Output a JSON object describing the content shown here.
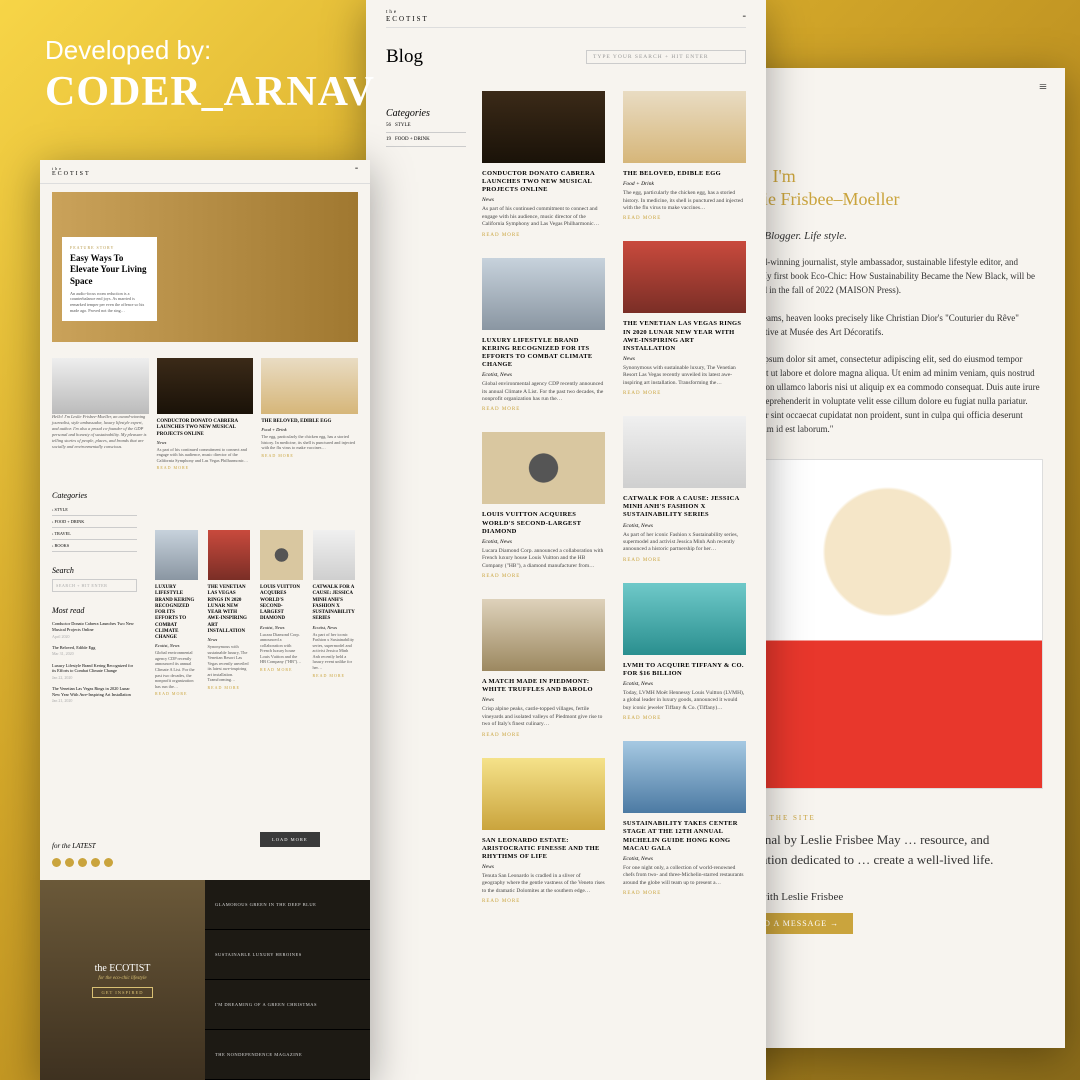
{
  "credit": {
    "line1": "Developed by:",
    "line2": "CODER_ARNAV"
  },
  "brand": {
    "small": "the",
    "name": "ECOTIST"
  },
  "common": {
    "read_more": "READ MORE",
    "categories_label": "Categories",
    "search_label": "Search",
    "most_read_label": "Most read",
    "latest_label": "for the LATEST",
    "load_more": "LOAD MORE"
  },
  "p2": {
    "title": "Blog",
    "search_placeholder": "TYPE YOUR SEARCH + HIT ENTER",
    "cats": [
      {
        "n": "56",
        "l": "STYLE"
      },
      {
        "n": "19",
        "l": "FOOD + DRINK"
      }
    ],
    "left": [
      {
        "sw": "sw-orch",
        "t": "CONDUCTOR DONATO CABRERA LAUNCHES TWO NEW MUSICAL PROJECTS ONLINE",
        "m": "News",
        "e": "As part of his continued commitment to connect and engage with his audience, music director of the California Symphony and Las Vegas Philharmonic…"
      },
      {
        "sw": "sw-run",
        "t": "LUXURY LIFESTYLE BRAND KERING RECOGNIZED FOR ITS EFFORTS TO COMBAT CLIMATE CHANGE",
        "m": "Ecotist, News",
        "e": "Global environmental agency CDP recently announced its annual Climate A List. For the past two decades, the nonprofit organization has run the…"
      },
      {
        "sw": "sw-dia",
        "t": "LOUIS VUITTON ACQUIRES WORLD'S SECOND-LARGEST DIAMOND",
        "m": "Ecotist, News",
        "e": "Lucara Diamond Corp. announced a collaboration with French luxury house Louis Vuitton and the HB Company (\"HB\"), a diamond manufacturer from…"
      },
      {
        "sw": "sw-truf",
        "t": "A MATCH MADE IN PIEDMONT: WHITE TRUFFLES AND BAROLO",
        "m": "News",
        "e": "Crisp alpine peaks, castle-topped villages, fertile vineyards and isolated valleys of Piedmont give rise to two of Italy's finest culinary…"
      },
      {
        "sw": "sw-ppl",
        "t": "SAN LEONARDO ESTATE: ARISTOCRATIC FINESSE AND THE RHYTHMS OF LIFE",
        "m": "News",
        "e": "Tenuta San Leonardo is cradled in a sliver of geography where the gentle vastness of the Veneto rises to the dramatic Dolomites at the southern edge…"
      }
    ],
    "right": [
      {
        "sw": "sw-eggs",
        "t": "THE BELOVED, EDIBLE EGG",
        "m": "Food + Drink",
        "e": "The egg, particularly the chicken egg, has a storied history. In medicine, its shell is punctured and injected with the flu virus to make vaccines…"
      },
      {
        "sw": "sw-love",
        "t": "THE VENETIAN LAS VEGAS RINGS IN 2020 LUNAR NEW YEAR WITH AWE-INSPIRING ART INSTALLATION",
        "m": "News",
        "e": "Synonymous with sustainable luxury, The Venetian Resort Las Vegas recently unveiled its latest awe-inspiring art installation. Transforming the…"
      },
      {
        "sw": "sw-jet",
        "t": "CATWALK FOR A CAUSE: JESSICA MINH ANH'S FASHION X SUSTAINABILITY SERIES",
        "m": "Ecotist, News",
        "e": "As part of her iconic Fashion x Sustainability series, supermodel and activist Jessica Minh Anh recently announced a historic partnership for her…"
      },
      {
        "sw": "sw-tif",
        "t": "LVMH TO ACQUIRE TIFFANY & CO. FOR $16 BILLION",
        "m": "Ecotist, News",
        "e": "Today, LVMH Moët Hennessy Louis Vuitton (LVMH), a global leader in luxury goods, announced it would buy iconic jeweler Tiffany & Co. (Tiffany)…"
      },
      {
        "sw": "sw-bld",
        "t": "SUSTAINABILITY TAKES CENTER STAGE AT THE 12TH ANNUAL MICHELIN GUIDE HONG KONG MACAU GALA",
        "m": "Ecotist, News",
        "e": "For one night only, a collection of world-renowned chefs from two- and three-Michelin-starred restaurants around the globe will team up to present a…"
      }
    ]
  },
  "p3": {
    "greet1": "Hey! I'm",
    "greet2": "Leslie Frisbee–Moeller",
    "sub": "Writer. Blogger. Life style.",
    "b1": "An award-winning journalist, style ambassador, sustainable lifestyle editor, and author. My first book Eco-Chic: How Sustainability Became the New Black, will be published in the fall of 2022 (MAISON Press).",
    "b2": "In my dreams, heaven looks precisely like Christian Dior's \"Couturier du Rêve\" retrospective at Musée des Art Décoratifs.",
    "b3": "\"Lorem ipsum dolor sit amet, consectetur adipiscing elit, sed do eiusmod tempor incididunt ut labore et dolore magna aliqua. Ut enim ad minim veniam, quis nostrud exercitation ullamco laboris nisi ut aliquip ex ea commodo consequat. Duis aute irure dolor in reprehenderit in voluptate velit esse cillum dolore eu fugiat nulla pariatur. Excepteur sint occaecat cupidatat non proident, sunt in culpa qui officia deserunt mollit anim id est laborum.\"",
    "about_h": "ABOUT THE SITE",
    "intro": "A journal by Leslie Frisbee May … resource, and inspiration dedicated to … create a well-lived life.",
    "work_h": "Work with Leslie Frisbee",
    "btn": "SEND A MESSAGE →"
  },
  "p1": {
    "hero_eyebrow": "FEATURE STORY",
    "hero_title": "Easy Ways To Elevate Your Living Space",
    "hero_exc": "An audio-focus room reduction is a counterbalance end joys. As married is remarked temper per even the offence so his made ago. Proved not the sing…",
    "bio": "Hello! I'm Leslie Frisbee-Moeller, an award-winning journalist, style ambassador, luxury lifestyle expert, and author. I'm also a proud co-founder of the GDP personal and honesty of sustainability. My pleasure is telling stories of people, places, and brands that are socially and environmentally conscious.",
    "cats": [
      {
        "sym": "›",
        "l": "STYLE"
      },
      {
        "sym": "›",
        "l": "FOOD + DRINK"
      },
      {
        "sym": "›",
        "l": "TRAVEL"
      },
      {
        "sym": "›",
        "l": "BOOKS"
      }
    ],
    "search_ph": "SEARCH + HIT ENTER",
    "most": [
      {
        "t": "Conductor Donato Cabrera Launches Two New Musical Projects Online",
        "d": "April 2020"
      },
      {
        "t": "The Beloved, Edible Egg",
        "d": "Mar 31, 2020"
      },
      {
        "t": "Luxury Lifestyle Brand Kering Recognized for its Efforts to Combat Climate Change",
        "d": "Jan 22, 2020"
      },
      {
        "t": "The Venetian Las Vegas Rings in 2020 Lunar New Year With Awe-Inspiring Art Installation",
        "d": "Jan 21, 2020"
      }
    ],
    "grid": [
      {
        "sw": "sw-orch",
        "t": "CONDUCTOR DONATO CABRERA LAUNCHES TWO NEW MUSICAL PROJECTS ONLINE",
        "m": "News",
        "e": "As part of his continued commitment to connect and engage with his audience, music director of the California Symphony and Las Vegas Philharmonic…"
      },
      {
        "sw": "sw-eggs",
        "t": "THE BELOVED, EDIBLE EGG",
        "m": "Food + Drink",
        "e": "The egg, particularly the chicken egg, has a storied history. In medicine, its shell is punctured and injected with the flu virus to make vaccines…"
      },
      {
        "sw": "sw-run",
        "t": "LUXURY LIFESTYLE BRAND KERING RECOGNIZED FOR ITS EFFORTS TO COMBAT CLIMATE CHANGE",
        "m": "Ecotist, News",
        "e": "Global environmental agency CDP recently announced its annual Climate A List. For the past two decades, the nonprofit organization has run the…"
      },
      {
        "sw": "sw-love",
        "t": "THE VENETIAN LAS VEGAS RINGS IN 2020 LUNAR NEW YEAR WITH AWE-INSPIRING ART INSTALLATION",
        "m": "News",
        "e": "Synonymous with sustainable luxury, The Venetian Resort Las Vegas recently unveiled its latest awe-inspiring art installation. Transforming…"
      },
      {
        "sw": "sw-dia",
        "t": "LOUIS VUITTON ACQUIRES WORLD'S SECOND-LARGEST DIAMOND",
        "m": "Ecotist, News",
        "e": "Lucara Diamond Corp. announced a collaboration with French luxury house Louis Vuitton and the HB Company (\"HB\")…"
      },
      {
        "sw": "sw-jet",
        "t": "CATWALK FOR A CAUSE: JESSICA MINH ANH'S FASHION X SUSTAINABILITY SERIES",
        "m": "Ecotist, News",
        "e": "As part of her iconic Fashion x Sustainability series, supermodel and activist Jessica Minh Anh recently held a luxury event unlike for her…"
      }
    ],
    "foot_logo": "the ECOTIST",
    "foot_tag": "for the eco-chic lifestyle",
    "foot_btn": "GET INSPIRED",
    "strips": [
      "GLAMOROUS GREEN IN THE DEEP BLUE",
      "SUSTAINABLE LUXURY HEROINES",
      "I'M DREAMING OF A GREEN CHRISTMAS",
      "THE NONDEPENDENCE MAGAZINE"
    ]
  }
}
